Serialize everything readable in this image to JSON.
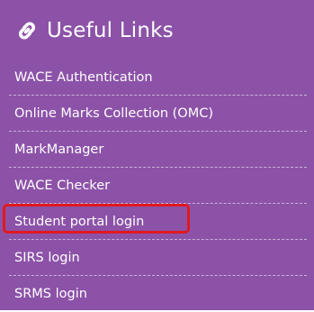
{
  "panel": {
    "background_color": "#8c52a8",
    "header": {
      "icon": "link-icon",
      "title": "Useful Links"
    },
    "links": [
      {
        "label": "WACE Authentication"
      },
      {
        "label": "Online Marks Collection (OMC)"
      },
      {
        "label": "MarkManager"
      },
      {
        "label": "WACE Checker"
      },
      {
        "label": "Student portal login",
        "highlighted": true
      },
      {
        "label": "SIRS login"
      },
      {
        "label": "SRMS login"
      }
    ],
    "highlight_color": "#e0191f"
  }
}
